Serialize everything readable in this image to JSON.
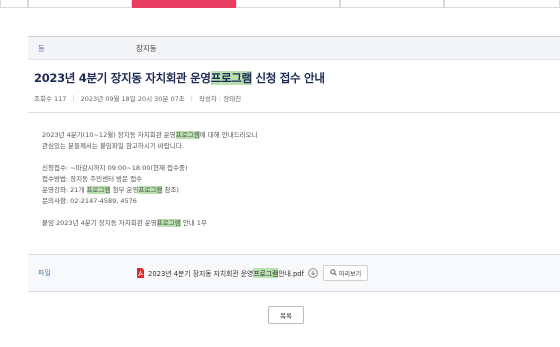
{
  "tabs": [
    {
      "label": "",
      "active": false
    },
    {
      "label": "",
      "active": false
    },
    {
      "label": "",
      "active": true
    },
    {
      "label": "",
      "active": false
    },
    {
      "label": "",
      "active": false
    },
    {
      "label": "",
      "active": false
    }
  ],
  "meta": {
    "dong_label": "동",
    "dong_value": "장지동"
  },
  "post": {
    "title_pre": "2023년 4분기 장지동 자치회관 운영",
    "title_hl": "프로그램",
    "title_post": " 신청 접수 안내",
    "views_label": "조회수 117",
    "date": "2023년 09월 18일 20시 30분 07초",
    "author": "작성자 : 장태진"
  },
  "body": {
    "line1_pre": "2023년 4분기(10~12월) 장지동 자치회관 운영",
    "line1_hl": "프로그램",
    "line1_post": "에 대해 안내드리오니",
    "line2": "관심있는 분들께서는 붙임파일 참고하시기 바랍니다.",
    "line3": "신청접수: ~마감시까지 09:00~18:00(현재 접수중)",
    "line4": "접수방법: 장지동 주민센터 방문 접수",
    "line5_pre": "운영강좌: 21개 ",
    "line5_hl1": "프로그램",
    "line5_mid": " 첨부 운영",
    "line5_hl2": "프로그램",
    "line5_post": " 참조)",
    "line6": "문의사항: 02-2147-4589, 4576",
    "attach_pre": "붙임   2023년 4분기 장지동 자치회관 운영",
    "attach_hl": "프로그램",
    "attach_post": " 안내 1부"
  },
  "file": {
    "label": "파일",
    "name_pre": "2023년 4분기 장지동 자치회관 운영",
    "name_hl": "프로그램",
    "name_post": " 안내.pdf",
    "preview_label": "미리보기"
  },
  "list_button": "목록",
  "colors": {
    "accent_tab": "#e83e63",
    "highlight": "#b9e1b0",
    "title": "#1e2a55",
    "label_blue": "#5b78b5"
  }
}
